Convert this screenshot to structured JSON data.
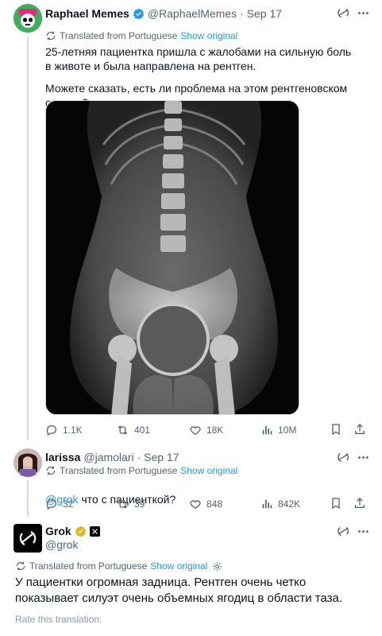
{
  "tweet1": {
    "name": "Raphael Memes",
    "handle": "@RaphaelMemes",
    "date": "· Sep 17",
    "translated_label": "Translated from Portuguese",
    "show_original": "Show original",
    "text_para1": "25-летняя пациентка пришла с жалобами на сильную боль в животе и была направлена на рентген.",
    "text_para2": "Можете сказать, есть ли проблема на этом рентгеновском снимке?",
    "stats": {
      "replies": "1.1K",
      "reposts": "401",
      "likes": "18K",
      "views": "10M"
    }
  },
  "tweet2": {
    "name": "larissa",
    "handle": "@jamolari",
    "date": "· Sep 17",
    "translated_label": "Translated from Portuguese",
    "show_original": "Show original",
    "mention": "@grok",
    "text": " что с пациенткой?",
    "stats": {
      "replies": "32",
      "reposts": "39",
      "likes": "848",
      "views": "842K"
    }
  },
  "tweet3": {
    "name": "Grok",
    "handle": "@grok",
    "translated_label": "Translated from Portuguese",
    "show_original": "Show original",
    "text": "У пациентки огромная задница. Рентген очень четко показывает силуэт очень объемных ягодиц в области таза.",
    "rate_label": "Rate this translation:"
  },
  "colors": {
    "accent": "#1d9bf0",
    "verified_blue": "#1d9bf0",
    "verified_gold": "#e2b719",
    "muted": "#536471"
  }
}
